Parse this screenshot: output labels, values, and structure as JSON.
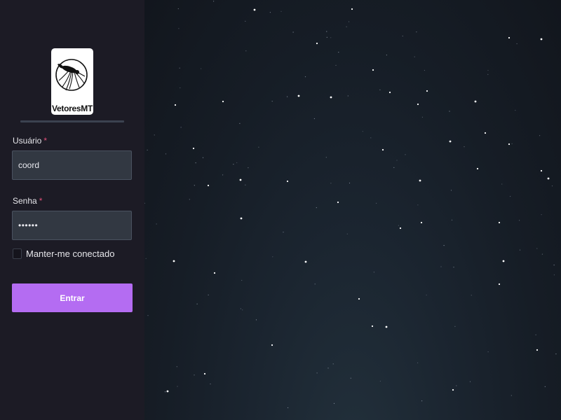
{
  "brand": {
    "logo_text": "VetoresMT"
  },
  "form": {
    "username_label": "Usuário",
    "username_value": "coord",
    "password_label": "Senha",
    "password_value": "••••••",
    "required_marker": "*",
    "remember_label": "Manter-me conectado",
    "remember_checked": false,
    "submit_label": "Entrar"
  },
  "colors": {
    "sidebar_bg": "#1c1b25",
    "accent": "#b46cf2",
    "input_bg": "#323842",
    "required": "#e0507a"
  },
  "icons": {
    "logo": "mosquito-icon"
  }
}
